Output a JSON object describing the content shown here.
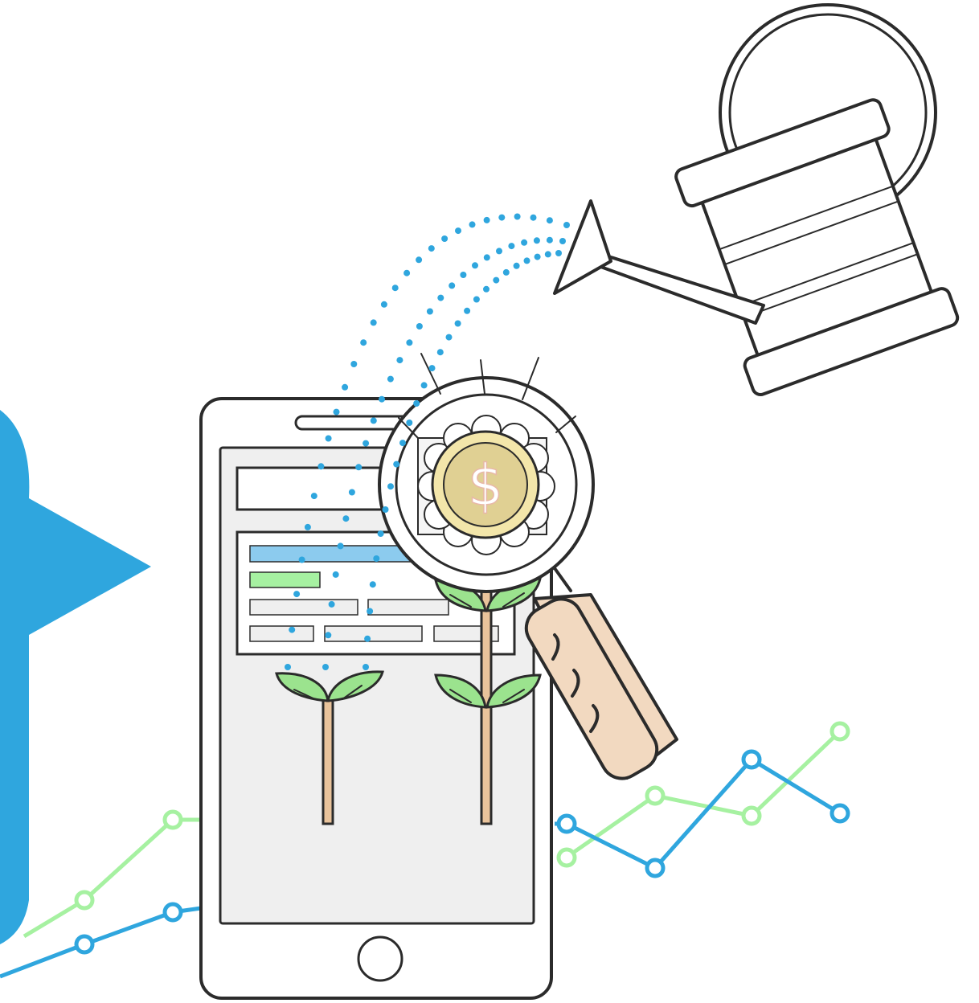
{
  "illustration": {
    "coin_symbol": "$",
    "colors": {
      "accent_blue": "#2fa6de",
      "accent_green": "#a6f1a1",
      "leaf_green": "#9be38e",
      "coin_gold": "#e0d093",
      "coin_rim": "#f3e6aa",
      "handle_tan": "#f2d9c0",
      "stem_tan": "#e9c39b",
      "outline": "#2b2b2b",
      "screen_gray": "#efefef"
    },
    "icons": [
      "watering-can-icon",
      "smartphone-icon",
      "magnifier-icon",
      "dollar-coin-icon",
      "sprout-icon",
      "line-chart-icon"
    ]
  }
}
